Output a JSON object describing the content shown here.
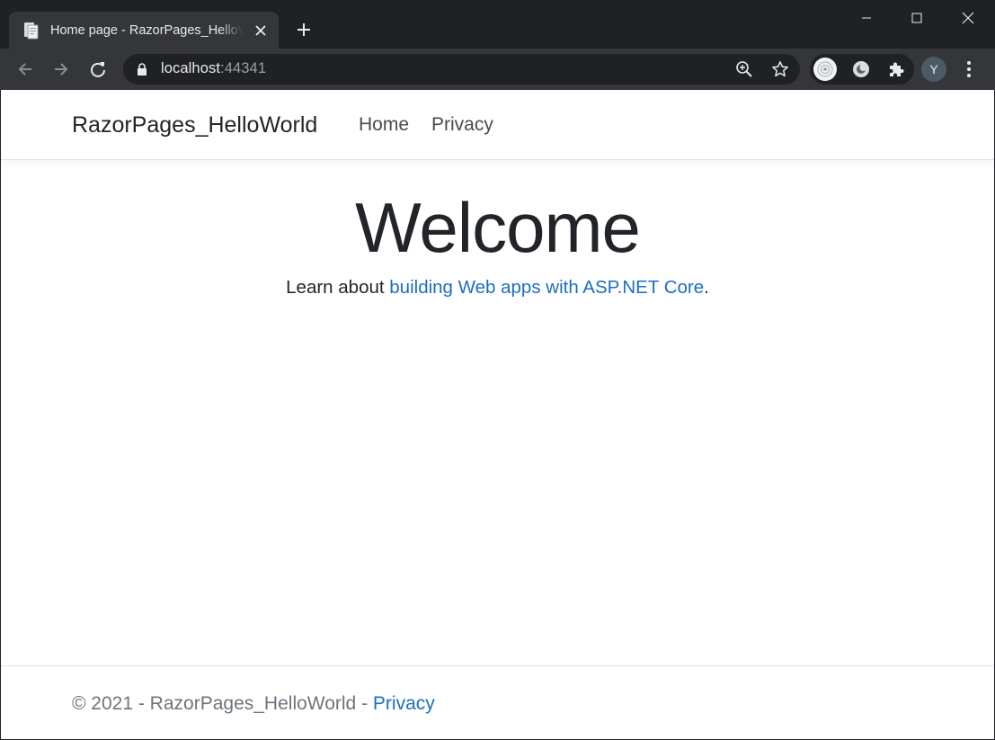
{
  "browser": {
    "tab_title": "Home page - RazorPages_HelloWorld",
    "url_host": "localhost",
    "url_port": ":44341",
    "avatar_letter": "Y"
  },
  "site": {
    "brand": "RazorPages_HelloWorld",
    "nav": {
      "home": "Home",
      "privacy": "Privacy"
    },
    "heading": "Welcome",
    "learn_prefix": "Learn about ",
    "learn_link": "building Web apps with ASP.NET Core",
    "learn_suffix": ".",
    "footer_text": "© 2021 - RazorPages_HelloWorld - ",
    "footer_link": "Privacy"
  },
  "colors": {
    "chrome_dark": "#202124",
    "chrome_toolbar": "#35363a",
    "link": "#1b6ec2",
    "text": "#212529",
    "muted": "#6c757d"
  }
}
